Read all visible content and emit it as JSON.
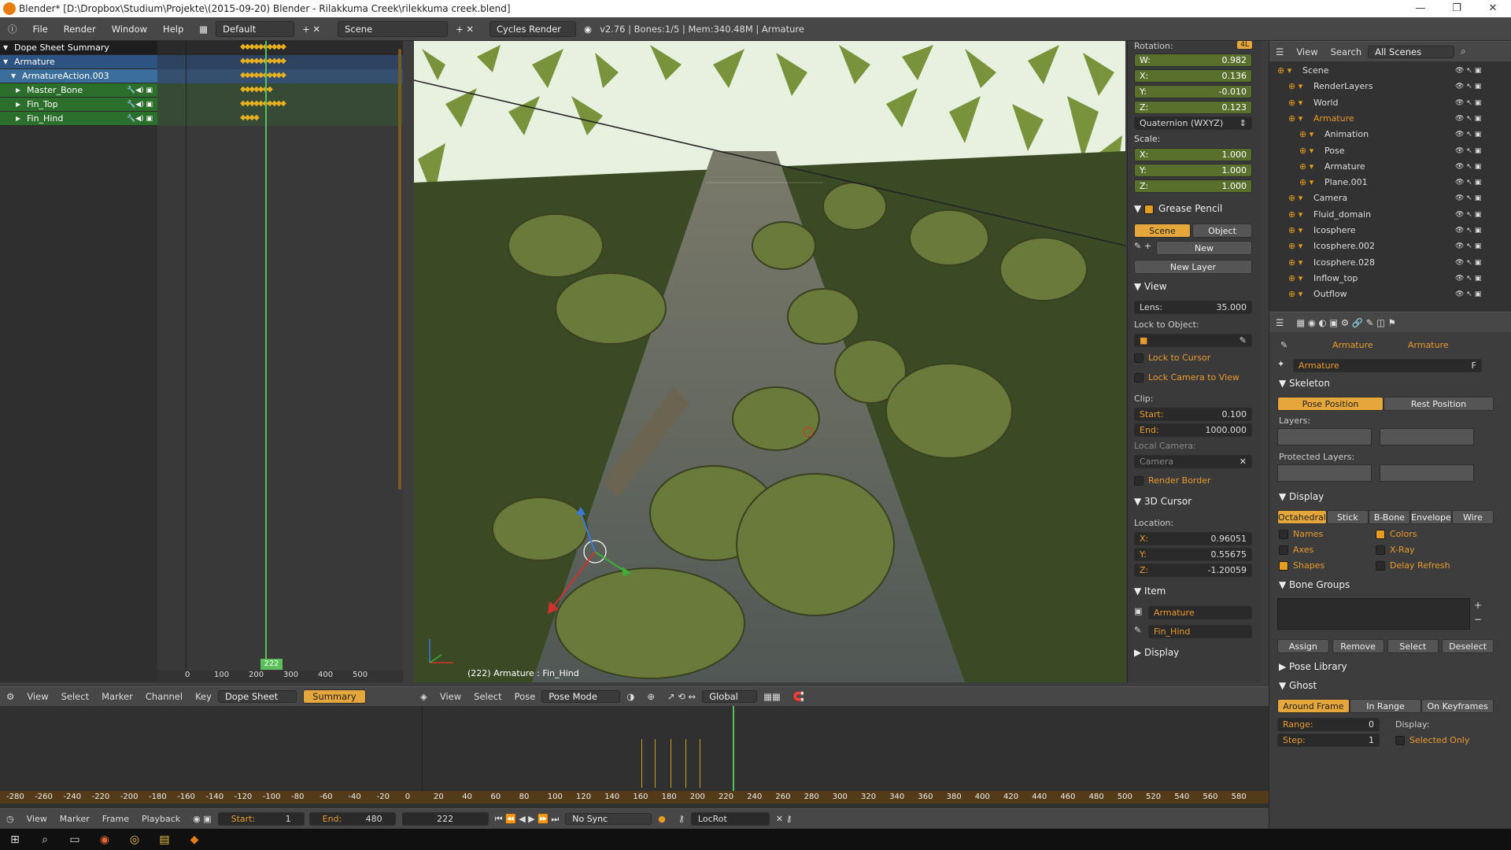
{
  "window": {
    "title": "Blender* [D:\\Dropbox\\Studium\\Projekte\\(2015-09-20) Blender - Rilakkuma Creek\\rilekkuma creek.blend]",
    "controls": [
      "—",
      "❐",
      "✕"
    ]
  },
  "infobar": {
    "menus": [
      "File",
      "Render",
      "Window",
      "Help"
    ],
    "layout": "Default",
    "scene": "Scene",
    "engine": "Cycles Render",
    "stats": "v2.76 | Bones:1/5 | Mem:340.48M | Armature"
  },
  "dopesheet": {
    "rows": [
      {
        "label": "Dope Sheet Summary",
        "kind": "summary"
      },
      {
        "label": "Armature",
        "kind": "obj"
      },
      {
        "label": "ArmatureAction.003",
        "kind": "act"
      },
      {
        "label": "Master_Bone",
        "kind": "grp"
      },
      {
        "label": "Fin_Top",
        "kind": "grp"
      },
      {
        "label": "Fin_Hind",
        "kind": "grp"
      }
    ],
    "current_frame": "222",
    "ruler": [
      "0",
      "100",
      "200",
      "300",
      "400",
      "500"
    ],
    "header": [
      "View",
      "Select",
      "Marker",
      "Channel",
      "Key"
    ],
    "mode": "Dope Sheet",
    "summary_btn": "Summary"
  },
  "viewport": {
    "overlay_label": "(222) Armature : Fin_Hind",
    "header": [
      "View",
      "Select",
      "Pose"
    ],
    "mode": "Pose Mode",
    "orientation": "Global"
  },
  "npanel": {
    "rotation_label": "Rotation:",
    "rotation_badge": "4L",
    "rotation": [
      [
        "W:",
        "0.982"
      ],
      [
        "X:",
        "0.136"
      ],
      [
        "Y:",
        "-0.010"
      ],
      [
        "Z:",
        "0.123"
      ]
    ],
    "rot_mode": "Quaternion (WXYZ)",
    "scale_label": "Scale:",
    "scale": [
      [
        "X:",
        "1.000"
      ],
      [
        "Y:",
        "1.000"
      ],
      [
        "Z:",
        "1.000"
      ]
    ],
    "grease_pencil": "Grease Pencil",
    "gp_scene": "Scene",
    "gp_object": "Object",
    "gp_new": "New",
    "gp_new_layer": "New Layer",
    "view_title": "View",
    "lens_label": "Lens:",
    "lens_value": "35.000",
    "lock_to_object": "Lock to Object:",
    "lock_to_cursor": "Lock to Cursor",
    "lock_cam_view": "Lock Camera to View",
    "clip_label": "Clip:",
    "clip_start_label": "Start:",
    "clip_start": "0.100",
    "clip_end_label": "End:",
    "clip_end": "1000.000",
    "local_camera": "Local Camera:",
    "camera_field": "Camera",
    "render_border": "Render Border",
    "cursor_title": "3D Cursor",
    "location_label": "Location:",
    "cursor": [
      [
        "X:",
        "0.96051"
      ],
      [
        "Y:",
        "0.55675"
      ],
      [
        "Z:",
        "-1.20059"
      ]
    ],
    "item_title": "Item",
    "item_object": "Armature",
    "item_bone": "Fin_Hind",
    "display_title": "Display"
  },
  "outliner": {
    "header": [
      "View",
      "Search",
      "All Scenes"
    ],
    "rows": [
      {
        "label": "Scene",
        "indent": 0
      },
      {
        "label": "RenderLayers",
        "indent": 1
      },
      {
        "label": "World",
        "indent": 1
      },
      {
        "label": "Armature",
        "indent": 1,
        "orange": true
      },
      {
        "label": "Animation",
        "indent": 2
      },
      {
        "label": "Pose",
        "indent": 2
      },
      {
        "label": "Armature",
        "indent": 2
      },
      {
        "label": "Plane.001",
        "indent": 2
      },
      {
        "label": "Camera",
        "indent": 1
      },
      {
        "label": "Fluid_domain",
        "indent": 1
      },
      {
        "label": "Icosphere",
        "indent": 1
      },
      {
        "label": "Icosphere.002",
        "indent": 1
      },
      {
        "label": "Icosphere.028",
        "indent": 1
      },
      {
        "label": "Inflow_top",
        "indent": 1
      },
      {
        "label": "Outflow",
        "indent": 1
      }
    ]
  },
  "properties": {
    "breadcrumb": [
      "Armature",
      "Armature"
    ],
    "name_field": "Armature",
    "name_suffix": "F",
    "skeleton": "Skeleton",
    "pose_position": "Pose Position",
    "rest_position": "Rest Position",
    "layers": "Layers:",
    "protected_layers": "Protected Layers:",
    "display": "Display",
    "display_tabs": [
      "Octahedral",
      "Stick",
      "B-Bone",
      "Envelope",
      "Wire"
    ],
    "checks": [
      {
        "label": "Names",
        "on": false
      },
      {
        "label": "Colors",
        "on": true
      },
      {
        "label": "Axes",
        "on": false
      },
      {
        "label": "X-Ray",
        "on": false
      },
      {
        "label": "Shapes",
        "on": true
      },
      {
        "label": "Delay Refresh",
        "on": false
      }
    ],
    "bone_groups": "Bone Groups",
    "bg_buttons": [
      "Assign",
      "Remove",
      "Select",
      "Deselect"
    ],
    "pose_library": "Pose Library",
    "ghost": "Ghost",
    "ghost_tabs": [
      "Around Frame",
      "In Range",
      "On Keyframes"
    ],
    "range_label": "Range:",
    "range_value": "0",
    "step_label": "Step:",
    "step_value": "1",
    "ghost_display": "Display:",
    "selected_only": "Selected Only"
  },
  "timeline": {
    "ruler": [
      "-280",
      "-260",
      "-240",
      "-220",
      "-200",
      "-180",
      "-160",
      "-140",
      "-120",
      "-100",
      "-80",
      "-60",
      "-40",
      "-20",
      "0",
      "20",
      "40",
      "60",
      "80",
      "100",
      "120",
      "140",
      "160",
      "180",
      "200",
      "220",
      "240",
      "260",
      "280",
      "300",
      "320",
      "340",
      "360",
      "380",
      "400",
      "420",
      "440",
      "460",
      "480",
      "500",
      "520",
      "540",
      "560",
      "580"
    ],
    "header": [
      "View",
      "Marker",
      "Frame",
      "Playback"
    ],
    "start_label": "Start:",
    "start": "1",
    "end_label": "End:",
    "end": "480",
    "current": "222",
    "sync": "No Sync",
    "keying": "LocRot"
  },
  "taskbar": [
    "⊞",
    "⌕",
    "▭",
    "◉",
    "◎",
    "▤",
    "◆"
  ]
}
